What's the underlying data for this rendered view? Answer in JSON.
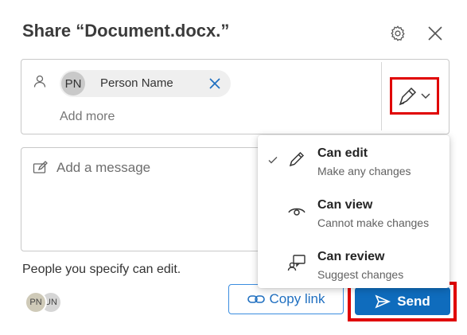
{
  "dialog": {
    "title": "Share “Document.docx.”"
  },
  "recipient": {
    "initials": "PN",
    "name": "Person Name",
    "add_more_placeholder": "Add more"
  },
  "message": {
    "placeholder": "Add a message"
  },
  "permission_menu": {
    "selected": "Can edit",
    "options": [
      {
        "title": "Can edit",
        "description": "Make any changes",
        "icon": "pencil-icon",
        "checked": true
      },
      {
        "title": "Can view",
        "description": "Cannot make changes",
        "icon": "eye-icon",
        "checked": false
      },
      {
        "title": "Can review",
        "description": "Suggest changes",
        "icon": "review-icon",
        "checked": false
      }
    ]
  },
  "footer": {
    "info_text": "People you specify can edit.",
    "avatars": [
      "PN",
      "UN"
    ],
    "copy_link_label": "Copy link",
    "send_label": "Send"
  },
  "colors": {
    "primary": "#0f6cbd",
    "link": "#1f6fc0",
    "highlight": "#e00000"
  }
}
